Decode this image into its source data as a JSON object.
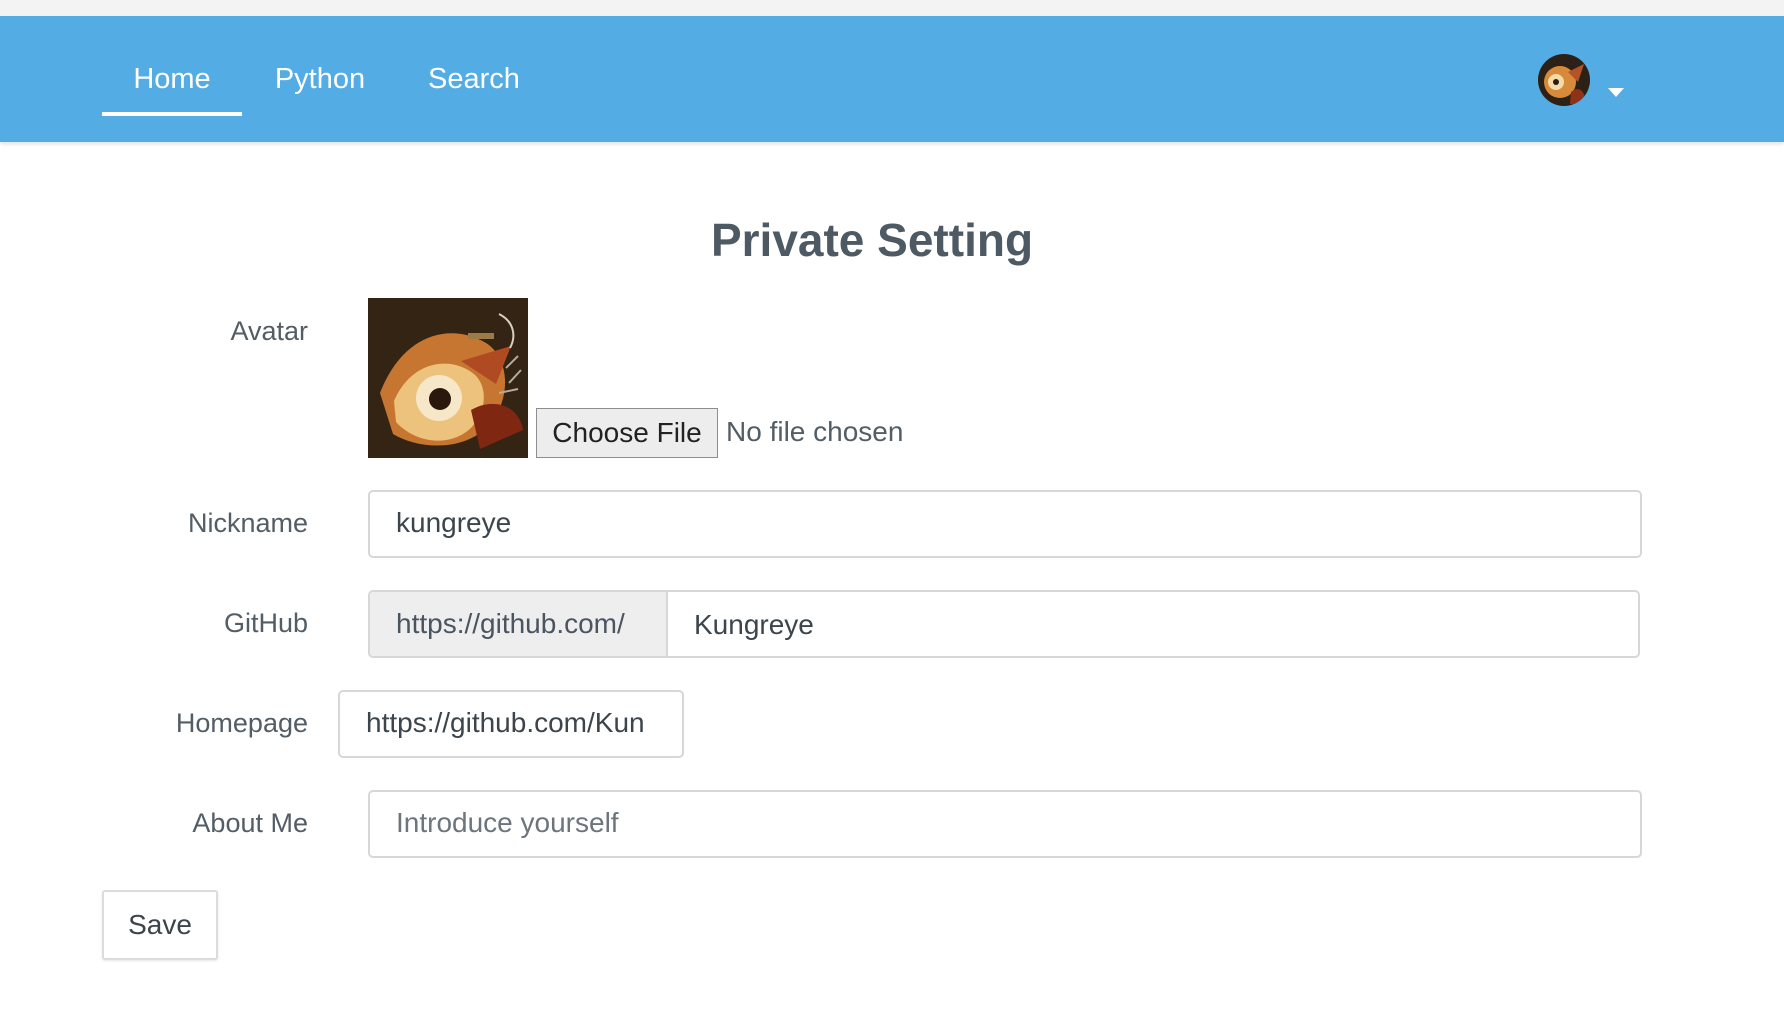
{
  "nav": {
    "items": [
      {
        "label": "Home",
        "active": true
      },
      {
        "label": "Python",
        "active": false
      },
      {
        "label": "Search",
        "active": false
      }
    ],
    "accent_color": "#53ace3",
    "user_menu_icon": "chevron-down-icon"
  },
  "page": {
    "title": "Private Setting"
  },
  "form": {
    "avatar": {
      "label": "Avatar",
      "file_button_label": "Choose File",
      "file_status": "No file chosen"
    },
    "nickname": {
      "label": "Nickname",
      "value": "kungreye"
    },
    "github": {
      "label": "GitHub",
      "prefix": "https://github.com/",
      "value": "Kungreye"
    },
    "homepage": {
      "label": "Homepage",
      "value": "https://github.com/Kun"
    },
    "about": {
      "label": "About Me",
      "placeholder": "Introduce yourself"
    },
    "save_label": "Save"
  }
}
